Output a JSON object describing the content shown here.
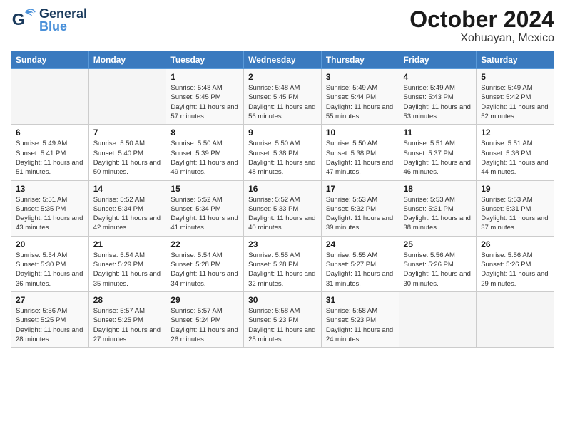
{
  "header": {
    "logo": {
      "general": "General",
      "blue": "Blue"
    },
    "title": "October 2024",
    "location": "Xohuayan, Mexico"
  },
  "days_of_week": [
    "Sunday",
    "Monday",
    "Tuesday",
    "Wednesday",
    "Thursday",
    "Friday",
    "Saturday"
  ],
  "weeks": [
    [
      {
        "day": "",
        "info": ""
      },
      {
        "day": "",
        "info": ""
      },
      {
        "day": "1",
        "info": "Sunrise: 5:48 AM\nSunset: 5:45 PM\nDaylight: 11 hours and 57 minutes."
      },
      {
        "day": "2",
        "info": "Sunrise: 5:48 AM\nSunset: 5:45 PM\nDaylight: 11 hours and 56 minutes."
      },
      {
        "day": "3",
        "info": "Sunrise: 5:49 AM\nSunset: 5:44 PM\nDaylight: 11 hours and 55 minutes."
      },
      {
        "day": "4",
        "info": "Sunrise: 5:49 AM\nSunset: 5:43 PM\nDaylight: 11 hours and 53 minutes."
      },
      {
        "day": "5",
        "info": "Sunrise: 5:49 AM\nSunset: 5:42 PM\nDaylight: 11 hours and 52 minutes."
      }
    ],
    [
      {
        "day": "6",
        "info": "Sunrise: 5:49 AM\nSunset: 5:41 PM\nDaylight: 11 hours and 51 minutes."
      },
      {
        "day": "7",
        "info": "Sunrise: 5:50 AM\nSunset: 5:40 PM\nDaylight: 11 hours and 50 minutes."
      },
      {
        "day": "8",
        "info": "Sunrise: 5:50 AM\nSunset: 5:39 PM\nDaylight: 11 hours and 49 minutes."
      },
      {
        "day": "9",
        "info": "Sunrise: 5:50 AM\nSunset: 5:38 PM\nDaylight: 11 hours and 48 minutes."
      },
      {
        "day": "10",
        "info": "Sunrise: 5:50 AM\nSunset: 5:38 PM\nDaylight: 11 hours and 47 minutes."
      },
      {
        "day": "11",
        "info": "Sunrise: 5:51 AM\nSunset: 5:37 PM\nDaylight: 11 hours and 46 minutes."
      },
      {
        "day": "12",
        "info": "Sunrise: 5:51 AM\nSunset: 5:36 PM\nDaylight: 11 hours and 44 minutes."
      }
    ],
    [
      {
        "day": "13",
        "info": "Sunrise: 5:51 AM\nSunset: 5:35 PM\nDaylight: 11 hours and 43 minutes."
      },
      {
        "day": "14",
        "info": "Sunrise: 5:52 AM\nSunset: 5:34 PM\nDaylight: 11 hours and 42 minutes."
      },
      {
        "day": "15",
        "info": "Sunrise: 5:52 AM\nSunset: 5:34 PM\nDaylight: 11 hours and 41 minutes."
      },
      {
        "day": "16",
        "info": "Sunrise: 5:52 AM\nSunset: 5:33 PM\nDaylight: 11 hours and 40 minutes."
      },
      {
        "day": "17",
        "info": "Sunrise: 5:53 AM\nSunset: 5:32 PM\nDaylight: 11 hours and 39 minutes."
      },
      {
        "day": "18",
        "info": "Sunrise: 5:53 AM\nSunset: 5:31 PM\nDaylight: 11 hours and 38 minutes."
      },
      {
        "day": "19",
        "info": "Sunrise: 5:53 AM\nSunset: 5:31 PM\nDaylight: 11 hours and 37 minutes."
      }
    ],
    [
      {
        "day": "20",
        "info": "Sunrise: 5:54 AM\nSunset: 5:30 PM\nDaylight: 11 hours and 36 minutes."
      },
      {
        "day": "21",
        "info": "Sunrise: 5:54 AM\nSunset: 5:29 PM\nDaylight: 11 hours and 35 minutes."
      },
      {
        "day": "22",
        "info": "Sunrise: 5:54 AM\nSunset: 5:28 PM\nDaylight: 11 hours and 34 minutes."
      },
      {
        "day": "23",
        "info": "Sunrise: 5:55 AM\nSunset: 5:28 PM\nDaylight: 11 hours and 32 minutes."
      },
      {
        "day": "24",
        "info": "Sunrise: 5:55 AM\nSunset: 5:27 PM\nDaylight: 11 hours and 31 minutes."
      },
      {
        "day": "25",
        "info": "Sunrise: 5:56 AM\nSunset: 5:26 PM\nDaylight: 11 hours and 30 minutes."
      },
      {
        "day": "26",
        "info": "Sunrise: 5:56 AM\nSunset: 5:26 PM\nDaylight: 11 hours and 29 minutes."
      }
    ],
    [
      {
        "day": "27",
        "info": "Sunrise: 5:56 AM\nSunset: 5:25 PM\nDaylight: 11 hours and 28 minutes."
      },
      {
        "day": "28",
        "info": "Sunrise: 5:57 AM\nSunset: 5:25 PM\nDaylight: 11 hours and 27 minutes."
      },
      {
        "day": "29",
        "info": "Sunrise: 5:57 AM\nSunset: 5:24 PM\nDaylight: 11 hours and 26 minutes."
      },
      {
        "day": "30",
        "info": "Sunrise: 5:58 AM\nSunset: 5:23 PM\nDaylight: 11 hours and 25 minutes."
      },
      {
        "day": "31",
        "info": "Sunrise: 5:58 AM\nSunset: 5:23 PM\nDaylight: 11 hours and 24 minutes."
      },
      {
        "day": "",
        "info": ""
      },
      {
        "day": "",
        "info": ""
      }
    ]
  ]
}
